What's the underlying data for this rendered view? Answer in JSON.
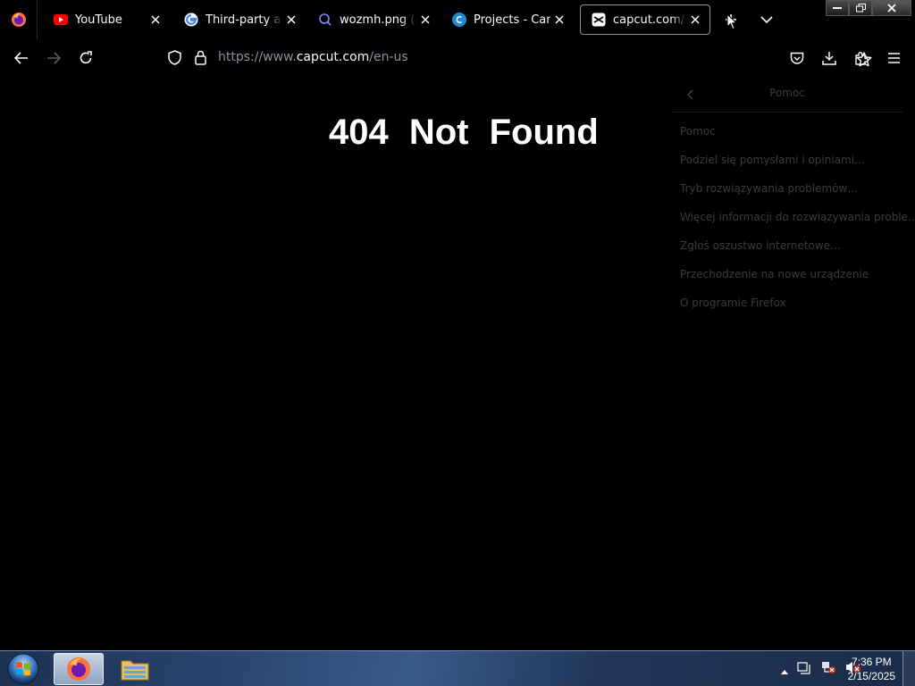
{
  "tabs": [
    {
      "title": "YouTube",
      "icon": "youtube-icon"
    },
    {
      "title": "Third-party apps",
      "icon": "google-icon"
    },
    {
      "title": "wozmh.png (obrazek",
      "icon": "image-search-icon"
    },
    {
      "title": "Projects - Canva",
      "icon": "canva-icon"
    },
    {
      "title": "capcut.com/en-us",
      "icon": "capcut-icon",
      "active": true
    }
  ],
  "urlbar": {
    "prefix": "https://www.",
    "host": "capcut.com",
    "path": "/en-us"
  },
  "page": {
    "heading": "404 Not Found"
  },
  "help_menu": {
    "title": "Pomoc",
    "items": [
      "Pomoc",
      "Podziel się pomysłami i opiniami…",
      "Tryb rozwiązywania problemów…",
      "Więcej informacji do rozwiązywania proble…",
      "Zgłoś oszustwo internetowe…",
      "Przechodzenie na nowe urządzenie",
      "O programie Firefox"
    ]
  },
  "taskbar": {
    "clock_time": "7:36 PM",
    "clock_date": "2/15/2025"
  },
  "colors": {
    "background": "#000000",
    "text": "#fbfbfe",
    "muted_text": "#8f8f9d",
    "help_text": "#3a3a3a",
    "youtube_red": "#ff0000",
    "canva_blue": "#1f8ad1"
  }
}
